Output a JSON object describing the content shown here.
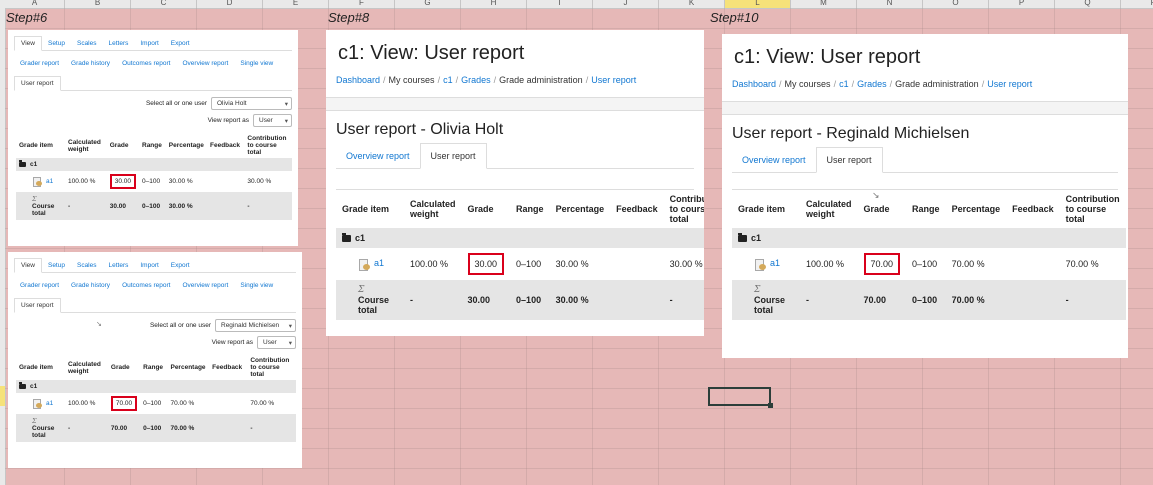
{
  "spreadsheet": {
    "columns": [
      {
        "label": "A",
        "w": 60
      },
      {
        "label": "B",
        "w": 66
      },
      {
        "label": "C",
        "w": 66
      },
      {
        "label": "D",
        "w": 66
      },
      {
        "label": "E",
        "w": 66
      },
      {
        "label": "F",
        "w": 66
      },
      {
        "label": "G",
        "w": 66
      },
      {
        "label": "H",
        "w": 66
      },
      {
        "label": "I",
        "w": 66
      },
      {
        "label": "J",
        "w": 66
      },
      {
        "label": "K",
        "w": 66
      },
      {
        "label": "L",
        "w": 66
      },
      {
        "label": "M",
        "w": 66
      },
      {
        "label": "N",
        "w": 66
      },
      {
        "label": "O",
        "w": 66
      },
      {
        "label": "P",
        "w": 66
      },
      {
        "label": "Q",
        "w": 66
      },
      {
        "label": "R",
        "w": 66
      }
    ],
    "selected_column": "L"
  },
  "steps": {
    "s6": "Step#6",
    "s8": "Step#8",
    "s10": "Step#10"
  },
  "panel_a": {
    "tabs": [
      "View",
      "Setup",
      "Scales",
      "Letters",
      "Import",
      "Export"
    ],
    "active_tab": "View",
    "subtabs": [
      "Grader report",
      "Grade history",
      "Outcomes report",
      "Overview report",
      "Single view"
    ],
    "subtab_active": "User report",
    "select_user_label": "Select all or one user",
    "select_user_value": "Olivia Holt",
    "view_as_label": "View report as",
    "view_as_value": "User",
    "headers": [
      "Grade item",
      "Calculated weight",
      "Grade",
      "Range",
      "Percentage",
      "Feedback",
      "Contribution to course total"
    ],
    "category": "c1",
    "item": {
      "name": "a1",
      "weight": "100.00 %",
      "grade": "30.00",
      "range": "0–100",
      "percentage": "30.00 %",
      "feedback": "",
      "contribution": "30.00 %"
    },
    "total": {
      "name": "Course total",
      "weight": "-",
      "grade": "30.00",
      "range": "0–100",
      "percentage": "30.00 %",
      "feedback": "",
      "contribution": "-"
    }
  },
  "panel_b": {
    "tabs": [
      "View",
      "Setup",
      "Scales",
      "Letters",
      "Import",
      "Export"
    ],
    "active_tab": "View",
    "subtabs": [
      "Grader report",
      "Grade history",
      "Outcomes report",
      "Overview report",
      "Single view"
    ],
    "subtab_active": "User report",
    "select_user_label": "Select all or one user",
    "select_user_value": "Reginald Michielsen",
    "view_as_label": "View report as",
    "view_as_value": "User",
    "headers": [
      "Grade item",
      "Calculated weight",
      "Grade",
      "Range",
      "Percentage",
      "Feedback",
      "Contribution to course total"
    ],
    "category": "c1",
    "item": {
      "name": "a1",
      "weight": "100.00 %",
      "grade": "70.00",
      "range": "0–100",
      "percentage": "70.00 %",
      "feedback": "",
      "contribution": "70.00 %"
    },
    "total": {
      "name": "Course total",
      "weight": "-",
      "grade": "70.00",
      "range": "0–100",
      "percentage": "70.00 %",
      "feedback": "",
      "contribution": "-"
    }
  },
  "panel_c": {
    "title": "c1: View: User report",
    "breadcrumb": [
      "Dashboard",
      "My courses",
      "c1",
      "Grades",
      "Grade administration",
      "User report"
    ],
    "breadcrumb_links": [
      true,
      false,
      true,
      true,
      false,
      true
    ],
    "subheading": "User report - Olivia Holt",
    "tabs": [
      "Overview report",
      "User report"
    ],
    "active_tab": "User report",
    "headers": [
      "Grade item",
      "Calculated weight",
      "Grade",
      "Range",
      "Percentage",
      "Feedback",
      "Contribution to course total"
    ],
    "category": "c1",
    "item": {
      "name": "a1",
      "weight": "100.00 %",
      "grade": "30.00",
      "range": "0–100",
      "percentage": "30.00 %",
      "feedback": "",
      "contribution": "30.00 %"
    },
    "total": {
      "name": "Course total",
      "weight": "-",
      "grade": "30.00",
      "range": "0–100",
      "percentage": "30.00 %",
      "feedback": "",
      "contribution": "-"
    }
  },
  "panel_d": {
    "title": "c1: View: User report",
    "breadcrumb": [
      "Dashboard",
      "My courses",
      "c1",
      "Grades",
      "Grade administration",
      "User report"
    ],
    "breadcrumb_links": [
      true,
      false,
      true,
      true,
      false,
      true
    ],
    "subheading": "User report - Reginald Michielsen",
    "tabs": [
      "Overview report",
      "User report"
    ],
    "active_tab": "User report",
    "headers": [
      "Grade item",
      "Calculated weight",
      "Grade",
      "Range",
      "Percentage",
      "Feedback",
      "Contribution to course total"
    ],
    "category": "c1",
    "item": {
      "name": "a1",
      "weight": "100.00 %",
      "grade": "70.00",
      "range": "0–100",
      "percentage": "70.00 %",
      "feedback": "",
      "contribution": "70.00 %"
    },
    "total": {
      "name": "Course total",
      "weight": "-",
      "grade": "70.00",
      "range": "0–100",
      "percentage": "70.00 %",
      "feedback": "",
      "contribution": "-"
    }
  },
  "icons": {
    "folder": "folder-icon",
    "assignment": "assignment-icon",
    "sigma": "Σ",
    "dropdown": "▾",
    "cursor": "↘"
  }
}
